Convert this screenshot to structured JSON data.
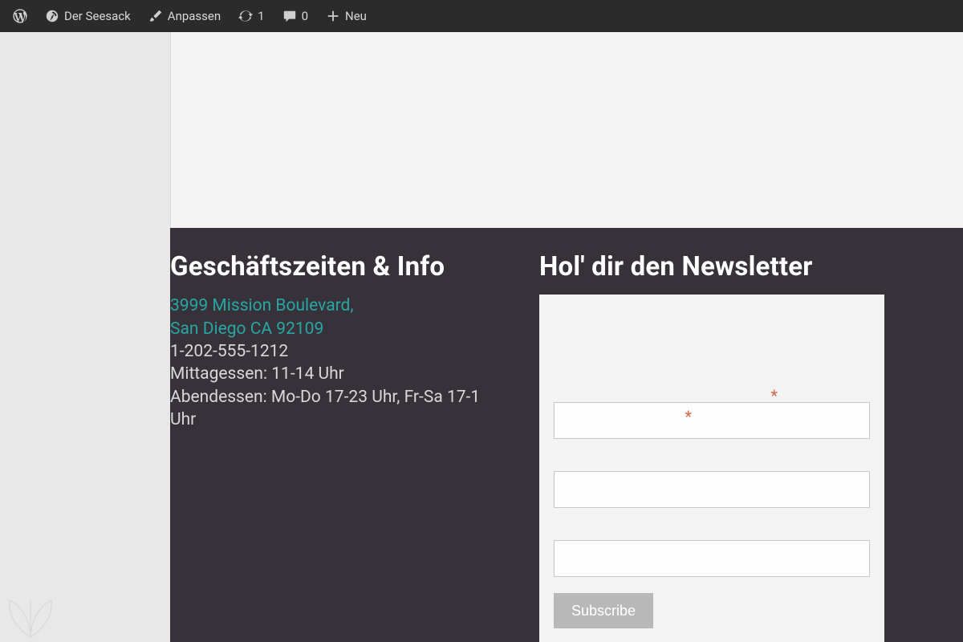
{
  "adminbar": {
    "site_name": "Der Seesack",
    "customize": "Anpassen",
    "updates_count": "1",
    "comments_count": "0",
    "new_label": "Neu"
  },
  "footer": {
    "hours_title": "Geschäftszeiten & Info",
    "address_line1": "3999 Mission Boulevard,",
    "address_line2": "San Diego CA 92109",
    "phone": "1-202-555-1212",
    "lunch": "Mittagessen: 11-14 Uhr",
    "dinner": "Abendessen: Mo-Do 17-23 Uhr, Fr-Sa 17-1 Uhr",
    "newsletter_title": "Hol' dir den Newsletter",
    "required_marker": "*",
    "subscribe_label": "Subscribe"
  }
}
